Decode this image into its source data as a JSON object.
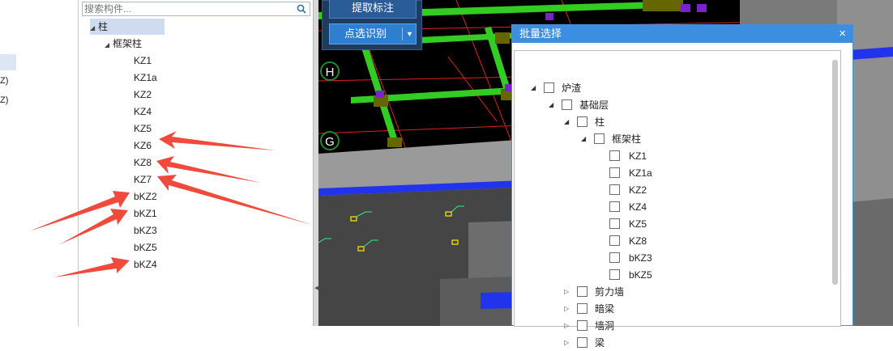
{
  "left_pane": {
    "fragments": [
      "Z)",
      "Z)"
    ]
  },
  "search": {
    "placeholder": "搜索构件..."
  },
  "tree": {
    "root_label": "柱",
    "group_label": "框架柱",
    "leaves": [
      "KZ1",
      "KZ1a",
      "KZ2",
      "KZ4",
      "KZ5",
      "KZ6",
      "KZ8",
      "KZ7",
      "bKZ2",
      "bKZ1",
      "bKZ3",
      "bKZ5",
      "bKZ4"
    ]
  },
  "viewport": {
    "extract_button": "提取标注",
    "pick_button": "点选识别",
    "axis_labels": [
      "H",
      "G"
    ]
  },
  "dialog": {
    "title": "批量选择",
    "close_label": "×",
    "floor": "炉渣",
    "level": "基础层",
    "category": "柱",
    "subgroup": "框架柱",
    "items": [
      "KZ1",
      "KZ1a",
      "KZ2",
      "KZ4",
      "KZ5",
      "KZ8",
      "bKZ3",
      "bKZ5"
    ],
    "other_categories": [
      "剪力墙",
      "暗梁",
      "墙洞",
      "梁"
    ]
  },
  "colors": {
    "dialog_title": "#3b8ee0",
    "annotation_arrows": "#f04a3c",
    "beams": "#33cc22",
    "slab_edge": "#2233ee"
  },
  "icons": {
    "search": "search-icon",
    "close": "close-icon",
    "dropdown": "chevron-down-icon"
  }
}
